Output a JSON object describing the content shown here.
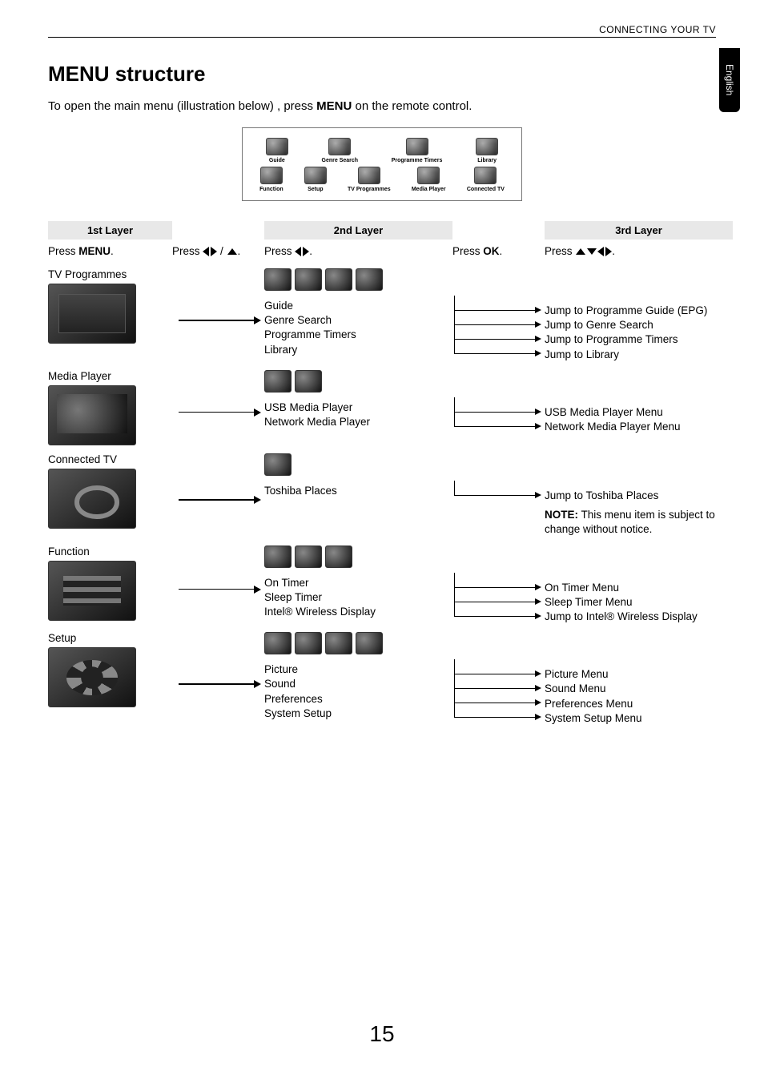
{
  "header": {
    "section": "CONNECTING YOUR TV"
  },
  "side_tab": "English",
  "title": "MENU structure",
  "intro": {
    "pre": "To open the main menu (illustration below) , press ",
    "key": "MENU",
    "post": " on the remote control."
  },
  "illustration": {
    "row1": [
      "Guide",
      "Genre Search",
      "Programme Timers",
      "Library"
    ],
    "row2": [
      "Function",
      "Setup",
      "TV Programmes",
      "Media Player",
      "Connected TV"
    ]
  },
  "layers": {
    "h1": "1st Layer",
    "h2": "2nd Layer",
    "h3": "3rd Layer",
    "s1_pre": "Press ",
    "s1_key": "MENU",
    "s1_post": ".",
    "s2_pre": "Press ",
    "s2_post": ".",
    "s3_pre": "Press ",
    "s3_post": ".",
    "s4_pre": "Press ",
    "s4_key": "OK",
    "s4_post": ".",
    "s5_pre": "Press ",
    "s5_post": "."
  },
  "rows": [
    {
      "title": "TV Programmes",
      "second": [
        "Guide",
        "Genre Search",
        "Programme Timers",
        "Library"
      ],
      "third": [
        "Jump to Programme Guide (EPG)",
        "Jump to Genre Search",
        "Jump to Programme Timers",
        "Jump to Library"
      ],
      "note": null,
      "iconCount": 4
    },
    {
      "title": "Media Player",
      "second": [
        "USB Media Player",
        "Network Media Player"
      ],
      "third": [
        "USB Media Player Menu",
        "Network Media Player Menu"
      ],
      "note": null,
      "iconCount": 2
    },
    {
      "title": "Connected TV",
      "second": [
        "Toshiba Places"
      ],
      "third": [
        "Jump to Toshiba Places"
      ],
      "note": {
        "bold": "NOTE:",
        "text": " This menu item is subject to change without notice."
      },
      "iconCount": 1
    },
    {
      "title": "Function",
      "second": [
        "On Timer",
        "Sleep Timer",
        "Intel® Wireless Display"
      ],
      "third": [
        "On Timer Menu",
        "Sleep Timer Menu",
        "Jump to Intel® Wireless Display"
      ],
      "note": null,
      "iconCount": 3
    },
    {
      "title": "Setup",
      "second": [
        "Picture",
        "Sound",
        "Preferences",
        "System Setup"
      ],
      "third": [
        "Picture Menu",
        "Sound Menu",
        "Preferences Menu",
        "System Setup Menu"
      ],
      "note": null,
      "iconCount": 4
    }
  ],
  "page_number": "15"
}
